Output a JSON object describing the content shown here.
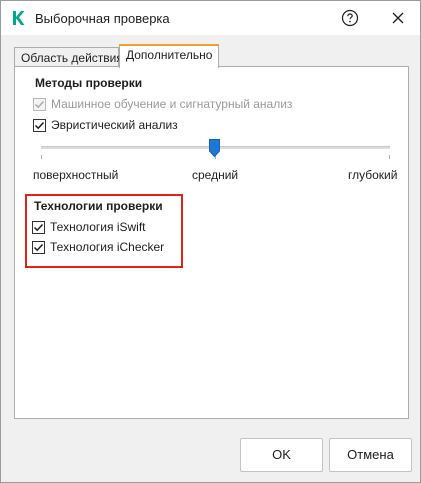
{
  "window": {
    "title": "Выборочная проверка",
    "help_icon": "help-circle-icon",
    "close_icon": "close-icon",
    "logo_icon": "kaspersky-k-logo",
    "brand_color": "#00a88e"
  },
  "tabs": [
    {
      "label": "Область действия",
      "active": false
    },
    {
      "label": "Дополнительно",
      "active": true
    }
  ],
  "methods": {
    "title": "Методы проверки",
    "ml_label": "Машинное обучение и сигнатурный анализ",
    "ml_checked": true,
    "ml_disabled": true,
    "heuristic_label": "Эвристический анализ",
    "heuristic_checked": true,
    "level_labels": [
      "поверхностный",
      "средний",
      "глубокий"
    ],
    "level_selected": "средний"
  },
  "technologies": {
    "title": "Технологии проверки",
    "iswift_label": "Технология iSwift",
    "iswift_checked": true,
    "ichecker_label": "Технология iChecker",
    "ichecker_checked": true,
    "highlight_color": "#e2231a"
  },
  "footer": {
    "ok_label": "OK",
    "cancel_label": "Отмена"
  }
}
